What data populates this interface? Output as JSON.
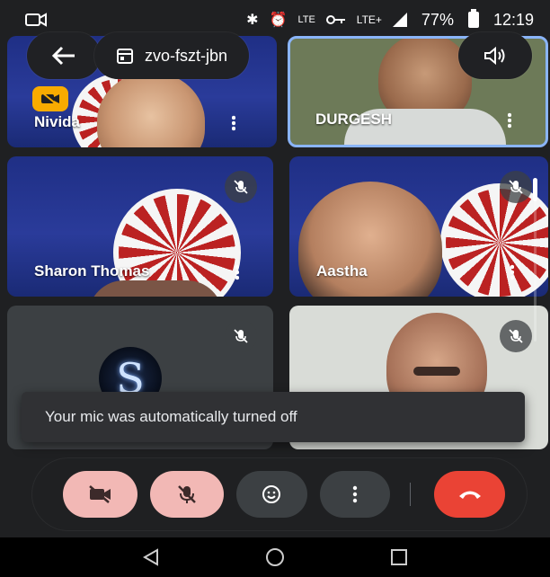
{
  "status": {
    "battery": "77%",
    "time": "12:19",
    "network_left": "LTE",
    "network_right": "LTE+"
  },
  "header": {
    "meeting_code": "zvo-fszt-jbn"
  },
  "participants": [
    {
      "name": "Nivida"
    },
    {
      "name": "DURGESH"
    },
    {
      "name": "Sharon Thomas"
    },
    {
      "name": "Aastha"
    },
    {
      "name": ""
    },
    {
      "name": ""
    }
  ],
  "toast": {
    "message": "Your mic was automatically turned off"
  },
  "icons": {
    "back": "arrow-left-icon",
    "calendar": "calendar-icon",
    "speaker": "speaker-icon",
    "camera_off": "camera-off-icon",
    "mic_off": "mic-off-icon",
    "emoji": "emoji-icon",
    "more": "more-vertical-icon",
    "hang_up": "phone-hangup-icon",
    "nav_back": "triangle-back-icon",
    "nav_home": "circle-home-icon",
    "nav_recent": "square-recent-icon"
  },
  "colors": {
    "accent_blue": "#8ab4f8",
    "hangup_red": "#ea4335",
    "muted_pink": "#f2b8b5",
    "badge_yellow": "#f9ab00"
  }
}
